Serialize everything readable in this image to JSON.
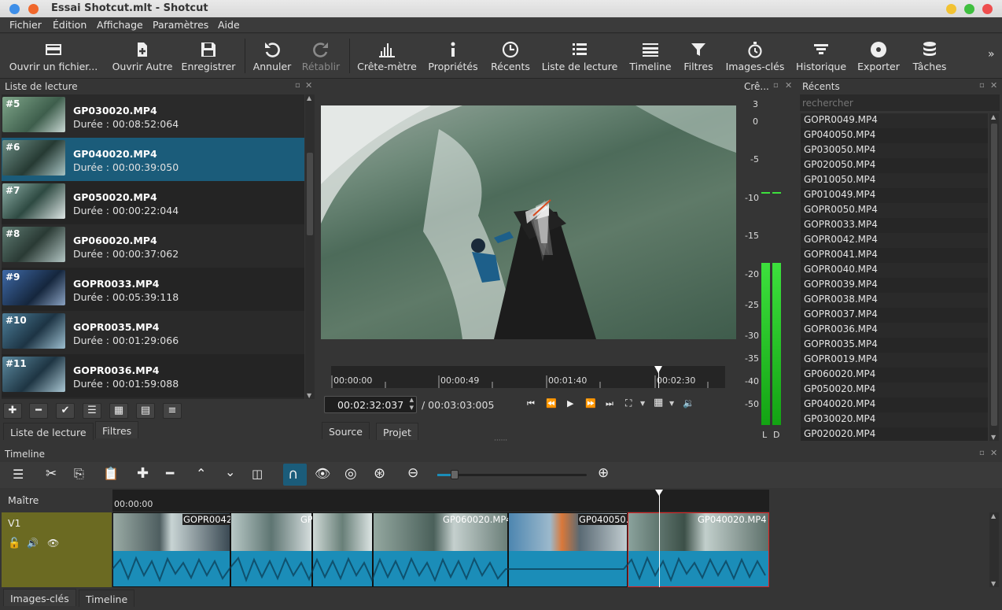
{
  "window": {
    "title": "Essai Shotcut.mlt - Shotcut"
  },
  "menu": [
    "Fichier",
    "Édition",
    "Affichage",
    "Paramètres",
    "Aide"
  ],
  "toolbar": [
    {
      "label": "Ouvrir un fichier...",
      "icon": "folder-open-icon",
      "disabled": false
    },
    {
      "label": "Ouvrir Autre",
      "icon": "open-other-icon",
      "disabled": false
    },
    {
      "label": "Enregistrer",
      "icon": "save-icon",
      "disabled": false
    },
    {
      "label": "Annuler",
      "icon": "undo-icon",
      "disabled": false
    },
    {
      "label": "Rétablir",
      "icon": "redo-icon",
      "disabled": true
    },
    {
      "label": "Crête-mètre",
      "icon": "peak-meter-icon",
      "disabled": false
    },
    {
      "label": "Propriétés",
      "icon": "info-icon",
      "disabled": false
    },
    {
      "label": "Récents",
      "icon": "clock-icon",
      "disabled": false
    },
    {
      "label": "Liste de lecture",
      "icon": "list-icon",
      "disabled": false
    },
    {
      "label": "Timeline",
      "icon": "timeline-icon",
      "disabled": false
    },
    {
      "label": "Filtres",
      "icon": "filter-icon",
      "disabled": false
    },
    {
      "label": "Images-clés",
      "icon": "stopwatch-icon",
      "disabled": false
    },
    {
      "label": "Historique",
      "icon": "history-icon",
      "disabled": false
    },
    {
      "label": "Exporter",
      "icon": "export-icon",
      "disabled": false
    },
    {
      "label": "Tâches",
      "icon": "jobs-icon",
      "disabled": false
    }
  ],
  "toolbar_overflow": "»",
  "playlist": {
    "title": "Liste de lecture",
    "items": [
      {
        "num": "#5",
        "name": "GP030020.MP4",
        "duration": "Durée : 00:08:52:064"
      },
      {
        "num": "#6",
        "name": "GP040020.MP4",
        "duration": "Durée : 00:00:39:050",
        "selected": true
      },
      {
        "num": "#7",
        "name": "GP050020.MP4",
        "duration": "Durée : 00:00:22:044"
      },
      {
        "num": "#8",
        "name": "GP060020.MP4",
        "duration": "Durée : 00:00:37:062"
      },
      {
        "num": "#9",
        "name": "GOPR0033.MP4",
        "duration": "Durée : 00:05:39:118"
      },
      {
        "num": "#10",
        "name": "GOPR0035.MP4",
        "duration": "Durée : 00:01:29:066"
      },
      {
        "num": "#11",
        "name": "GOPR0036.MP4",
        "duration": "Durée : 00:01:59:088"
      }
    ],
    "tabs": [
      "Liste de lecture",
      "Filtres"
    ]
  },
  "player": {
    "ruler": [
      "00:00:00",
      "00:00:49",
      "00:01:40",
      "00:02:30"
    ],
    "position": "00:02:32:037",
    "duration": "/ 00:03:03:005",
    "tabs": [
      "Source",
      "Projet"
    ],
    "playhead_fraction": 0.83
  },
  "meter": {
    "title": "Crê...",
    "scale": [
      "3",
      "0",
      "-5",
      "-10",
      "-15",
      "-20",
      "-25",
      "-30",
      "-35",
      "-40",
      "-50"
    ],
    "channels": [
      "L",
      "D"
    ],
    "level_db": -20,
    "peak_db": -9
  },
  "recent": {
    "title": "Récents",
    "search_placeholder": "rechercher",
    "items": [
      "GOPR0049.MP4",
      "GP040050.MP4",
      "GP030050.MP4",
      "GP020050.MP4",
      "GP010050.MP4",
      "GP010049.MP4",
      "GOPR0050.MP4",
      "GOPR0033.MP4",
      "GOPR0042.MP4",
      "GOPR0041.MP4",
      "GOPR0040.MP4",
      "GOPR0039.MP4",
      "GOPR0038.MP4",
      "GOPR0037.MP4",
      "GOPR0036.MP4",
      "GOPR0035.MP4",
      "GOPR0019.MP4",
      "GP060020.MP4",
      "GP050020.MP4",
      "GP040020.MP4",
      "GP030020.MP4",
      "GP020020.MP4"
    ]
  },
  "timeline": {
    "title": "Timeline",
    "master": "Maître",
    "track": "V1",
    "start_time": "00:00:00",
    "clips": [
      "GOPR0042.",
      "GP",
      "",
      "GP060020.MP4",
      "GP040050.I",
      "GP040020.MP4"
    ],
    "tabs": [
      "Images-clés",
      "Timeline"
    ]
  },
  "colors": {
    "accent": "#1b6a8c",
    "selected_row": "#1b5c7a",
    "track_header": "#6b6a22",
    "clip_audio": "#1b8db8",
    "meter_green": "#1fbf1f"
  }
}
